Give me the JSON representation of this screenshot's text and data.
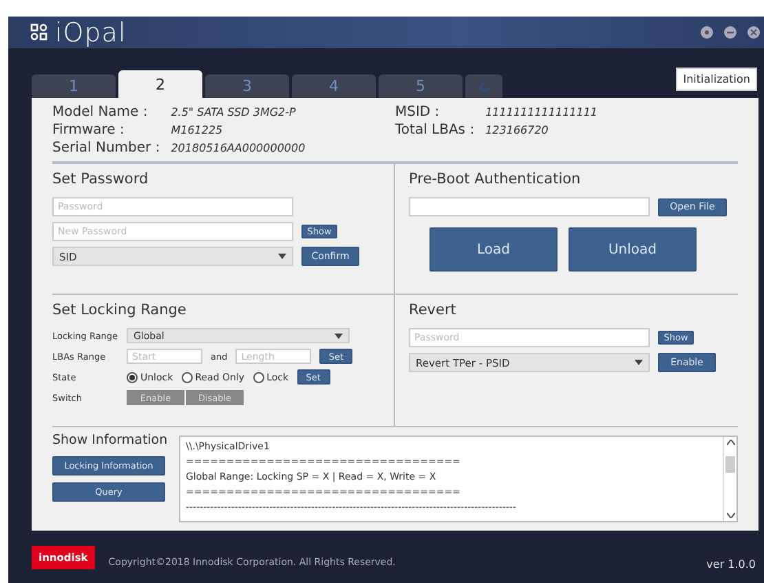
{
  "window": {
    "title": "iOpal"
  },
  "tabs": [
    {
      "kind": "text",
      "label": "1",
      "selected": false
    },
    {
      "kind": "text",
      "label": "2",
      "selected": true
    },
    {
      "kind": "text",
      "label": "3",
      "selected": false
    },
    {
      "kind": "text",
      "label": "4",
      "selected": false
    },
    {
      "kind": "text",
      "label": "5",
      "selected": false
    },
    {
      "kind": "refresh",
      "selected": false
    }
  ],
  "initialization_button": "Initialization",
  "device_info": {
    "left": [
      {
        "label": "Model Name :",
        "value": "2.5\" SATA SSD 3MG2-P"
      },
      {
        "label": "Firmware :",
        "value": "M161225"
      },
      {
        "label": "Serial Number :",
        "value": "20180516AA000000000"
      }
    ],
    "right": [
      {
        "label": "MSID :",
        "value": "1111111111111111"
      },
      {
        "label": "Total LBAs :",
        "value": "123166720"
      }
    ]
  },
  "set_password": {
    "title": "Set Password",
    "password_placeholder": "Password",
    "new_password_placeholder": "New Password",
    "show_button": "Show",
    "dropdown": "SID",
    "confirm_button": "Confirm"
  },
  "pre_boot": {
    "title": "Pre-Boot Authentication",
    "open_file_button": "Open File",
    "load_button": "Load",
    "unload_button": "Unload"
  },
  "locking_range": {
    "title": "Set Locking Range",
    "range_label": "Locking Range",
    "range_value": "Global",
    "lba_label": "LBAs Range",
    "start_placeholder": "Start",
    "and_label": "and",
    "length_placeholder": "Length",
    "set_button": "Set",
    "state_label": "State",
    "states": [
      {
        "label": "Unlock",
        "selected": true
      },
      {
        "label": "Read Only",
        "selected": false
      },
      {
        "label": "Lock",
        "selected": false
      }
    ],
    "state_set_button": "Set",
    "switch_label": "Switch",
    "switch_buttons": [
      "Enable",
      "Disable"
    ]
  },
  "revert": {
    "title": "Revert",
    "password_placeholder": "Password",
    "show_button": "Show",
    "dropdown": "Revert TPer - PSID",
    "enable_button": "Enable"
  },
  "show_information": {
    "title": "Show Information",
    "buttons": [
      "Locking Information",
      "Query"
    ],
    "lines": [
      "\\\\.\\PhysicalDrive1",
      "==================================",
      "Global Range: Locking SP = X | Read = X, Write = X",
      "==================================",
      "-----------------------------------------------------------------------------------------------"
    ]
  },
  "footer": {
    "brand": "innodisk",
    "copyright": "Copyright©2018 Innodisk Corporation. All Rights Reserved.",
    "version": "ver 1.0.0"
  }
}
